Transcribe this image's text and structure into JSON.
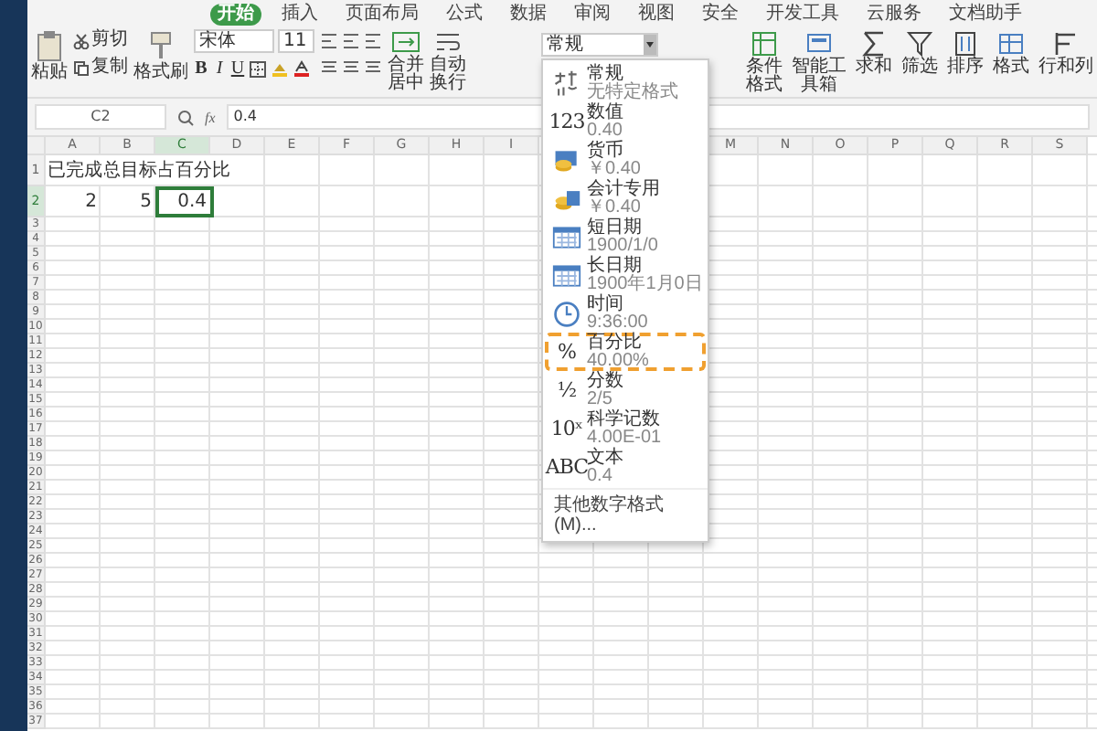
{
  "tabs": [
    {
      "label": "开始",
      "selected": true
    },
    {
      "label": "插入",
      "selected": false
    },
    {
      "label": "页面布局",
      "selected": false
    },
    {
      "label": "公式",
      "selected": false
    },
    {
      "label": "数据",
      "selected": false
    },
    {
      "label": "审阅",
      "selected": false
    },
    {
      "label": "视图",
      "selected": false
    },
    {
      "label": "安全",
      "selected": false
    },
    {
      "label": "开发工具",
      "selected": false
    },
    {
      "label": "云服务",
      "selected": false
    },
    {
      "label": "文档助手",
      "selected": false
    }
  ],
  "ribbon": {
    "paste": "粘贴",
    "cut": "剪切",
    "copy": "复制",
    "format_painter": "格式刷",
    "font_name": "宋体",
    "font_size": "11",
    "bold": "B",
    "italic": "I",
    "underline": "U",
    "merge": "合并居中",
    "wrap": "自动换行",
    "number_format": "常规",
    "tools": [
      {
        "label": "条件格式",
        "kind": "conditional"
      },
      {
        "label": "智能工具箱",
        "kind": "toolbox"
      },
      {
        "label": "求和",
        "kind": "sum"
      },
      {
        "label": "筛选",
        "kind": "filter"
      },
      {
        "label": "排序",
        "kind": "sort"
      },
      {
        "label": "格式",
        "kind": "format"
      },
      {
        "label": "行和列",
        "kind": "rows"
      }
    ]
  },
  "formula_bar": {
    "name_box": "C2",
    "fx": "fx",
    "value": "0.4"
  },
  "sheet": {
    "columns_left": [
      {
        "label": "A",
        "selected": false
      },
      {
        "label": "B",
        "selected": false
      },
      {
        "label": "C",
        "selected": true
      },
      {
        "label": "D",
        "selected": false
      },
      {
        "label": "E",
        "selected": false
      },
      {
        "label": "F",
        "selected": false
      },
      {
        "label": "G",
        "selected": false
      },
      {
        "label": "H",
        "selected": false
      },
      {
        "label": "I",
        "selected": false
      }
    ],
    "columns_right": [
      {
        "label": "M",
        "selected": false
      },
      {
        "label": "N",
        "selected": false
      },
      {
        "label": "O",
        "selected": false
      },
      {
        "label": "P",
        "selected": false
      },
      {
        "label": "Q",
        "selected": false
      },
      {
        "label": "R",
        "selected": false
      },
      {
        "label": "S",
        "selected": false
      }
    ],
    "rows": [
      {
        "number": "1",
        "selected": false,
        "cells": [
          {
            "text": "已完成",
            "kind": "text",
            "selected": false
          },
          {
            "text": "总目标",
            "kind": "text",
            "selected": false
          },
          {
            "text": "占百分比",
            "kind": "text",
            "selected": false
          }
        ]
      },
      {
        "number": "2",
        "selected": true,
        "cells": [
          {
            "text": "2",
            "kind": "number",
            "selected": false
          },
          {
            "text": "5",
            "kind": "number",
            "selected": false
          },
          {
            "text": "0.4",
            "kind": "number",
            "selected": true
          }
        ]
      },
      {
        "number": "3",
        "selected": false
      },
      {
        "number": "4",
        "selected": false
      },
      {
        "number": "5",
        "selected": false
      },
      {
        "number": "6",
        "selected": false
      },
      {
        "number": "7",
        "selected": false
      },
      {
        "number": "8",
        "selected": false
      },
      {
        "number": "9",
        "selected": false
      },
      {
        "number": "10",
        "selected": false
      },
      {
        "number": "11",
        "selected": false
      },
      {
        "number": "12",
        "selected": false
      },
      {
        "number": "13",
        "selected": false
      },
      {
        "number": "14",
        "selected": false
      },
      {
        "number": "15",
        "selected": false
      },
      {
        "number": "16",
        "selected": false
      },
      {
        "number": "17",
        "selected": false
      },
      {
        "number": "18",
        "selected": false
      },
      {
        "number": "19",
        "selected": false
      },
      {
        "number": "20",
        "selected": false
      },
      {
        "number": "21",
        "selected": false
      },
      {
        "number": "22",
        "selected": false
      },
      {
        "number": "23",
        "selected": false
      },
      {
        "number": "24",
        "selected": false
      },
      {
        "number": "25",
        "selected": false
      },
      {
        "number": "26",
        "selected": false
      },
      {
        "number": "27",
        "selected": false
      },
      {
        "number": "28",
        "selected": false
      },
      {
        "number": "29",
        "selected": false
      },
      {
        "number": "30",
        "selected": false
      },
      {
        "number": "31",
        "selected": false
      },
      {
        "number": "32",
        "selected": false
      },
      {
        "number": "33",
        "selected": false
      },
      {
        "number": "34",
        "selected": false
      },
      {
        "number": "35",
        "selected": false
      },
      {
        "number": "36",
        "selected": false
      },
      {
        "number": "37",
        "selected": false
      }
    ]
  },
  "format_menu": {
    "items": [
      {
        "kind": "general",
        "title": "常规",
        "sample": "无特定格式",
        "selected": false
      },
      {
        "kind": "text",
        "icon_text": "123",
        "title": "数值",
        "sample": "0.40",
        "selected": false
      },
      {
        "kind": "currency",
        "title": "货币",
        "sample": "￥0.40",
        "selected": false
      },
      {
        "kind": "accounting",
        "title": "会计专用",
        "sample": "￥0.40",
        "selected": false
      },
      {
        "kind": "date",
        "title": "短日期",
        "sample": "1900/1/0",
        "selected": false
      },
      {
        "kind": "date",
        "title": "长日期",
        "sample": "1900年1月0日",
        "selected": false
      },
      {
        "kind": "clock",
        "title": "时间",
        "sample": "9:36:00",
        "selected": false
      },
      {
        "kind": "text",
        "icon_text": "%",
        "title": "百分比",
        "sample": "40.00%",
        "selected": true
      },
      {
        "kind": "text",
        "icon_text": "½",
        "title": "分数",
        "sample": "2/5",
        "selected": false
      },
      {
        "kind": "text",
        "icon_text": "10ˣ",
        "title": "科学记数",
        "sample": "4.00E-01",
        "selected": false
      },
      {
        "kind": "text",
        "icon_text": "ABC",
        "title": "文本",
        "sample": "0.4",
        "selected": false
      }
    ],
    "footer": "其他数字格式(M)..."
  }
}
